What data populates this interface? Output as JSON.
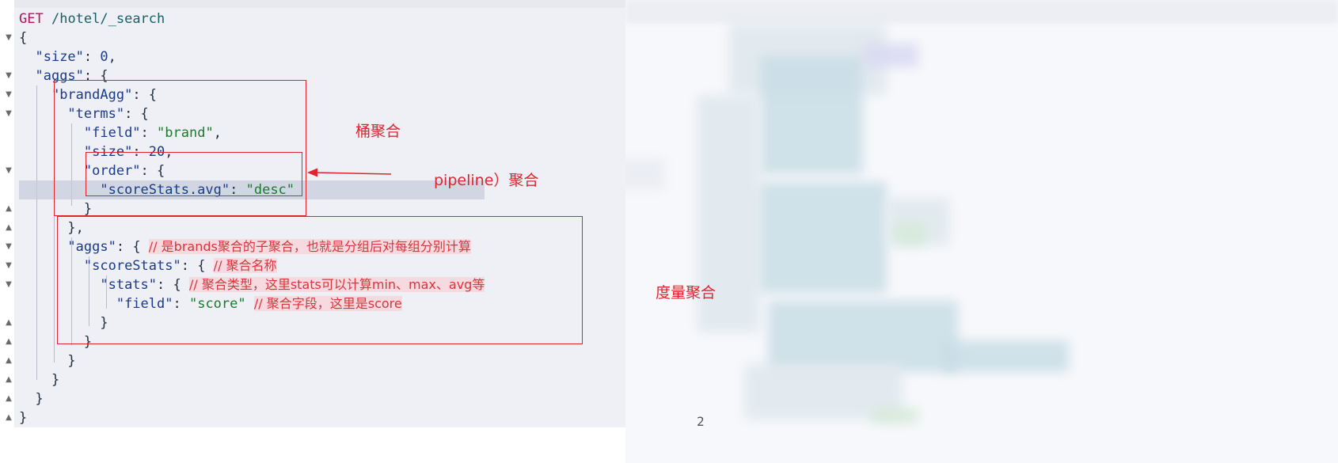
{
  "editor": {
    "request_method": "GET",
    "request_path": "/hotel/_search",
    "lines": [
      {
        "type": "request"
      },
      {
        "text": "{"
      },
      {
        "indent": "  ",
        "key": "\"size\"",
        "rest": ": ",
        "value": "0",
        "tail": ","
      },
      {
        "indent": "  ",
        "key": "\"aggs\"",
        "rest": ": {"
      },
      {
        "indent": "    ",
        "key": "\"brandAgg\"",
        "rest": ": {"
      },
      {
        "indent": "      ",
        "key": "\"terms\"",
        "rest": ": {"
      },
      {
        "indent": "        ",
        "key": "\"field\"",
        "rest": ": ",
        "string": "\"brand\"",
        "tail": ","
      },
      {
        "indent": "        ",
        "key": "\"size\"",
        "rest": ": ",
        "value": "20",
        "tail": ","
      },
      {
        "indent": "        ",
        "key": "\"order\"",
        "rest": ": {"
      },
      {
        "indent": "          ",
        "key": "\"scoreStats.avg\"",
        "rest": ": ",
        "string": "\"desc\""
      },
      {
        "indent": "        ",
        "rest": "}"
      },
      {
        "indent": "      ",
        "rest": "},"
      },
      {
        "indent": "      ",
        "key": "\"aggs\"",
        "rest": ": { ",
        "comment": "// 是brands聚合的子聚合，也就是分组后对每组分别计算"
      },
      {
        "indent": "        ",
        "key": "\"scoreStats\"",
        "rest": ": { ",
        "comment": "// 聚合名称"
      },
      {
        "indent": "          ",
        "key": "\"stats\"",
        "rest": ": { ",
        "comment": "// 聚合类型，这里stats可以计算min、max、avg等"
      },
      {
        "indent": "            ",
        "key": "\"field\"",
        "rest": ": ",
        "string": "\"score\"",
        "tail": " ",
        "comment": "// 聚合字段，这里是score"
      },
      {
        "indent": "          ",
        "rest": "}"
      },
      {
        "indent": "        ",
        "rest": "}"
      },
      {
        "indent": "      ",
        "rest": "}"
      },
      {
        "indent": "    ",
        "rest": "}"
      },
      {
        "indent": "  ",
        "rest": "}"
      },
      {
        "rest": "}"
      }
    ]
  },
  "annotations": {
    "bucket_label": "桶聚合",
    "pipeline_label": "pipeline）聚合",
    "metric_label": "度量聚合"
  },
  "right_panel": {
    "bottom_text": "2"
  },
  "colors": {
    "annotation_red": "#e0232f",
    "editor_bg": "#eef0f5",
    "method_color": "#b0155a",
    "string_color": "#1b7a2c",
    "key_color": "#1a3a8a"
  }
}
